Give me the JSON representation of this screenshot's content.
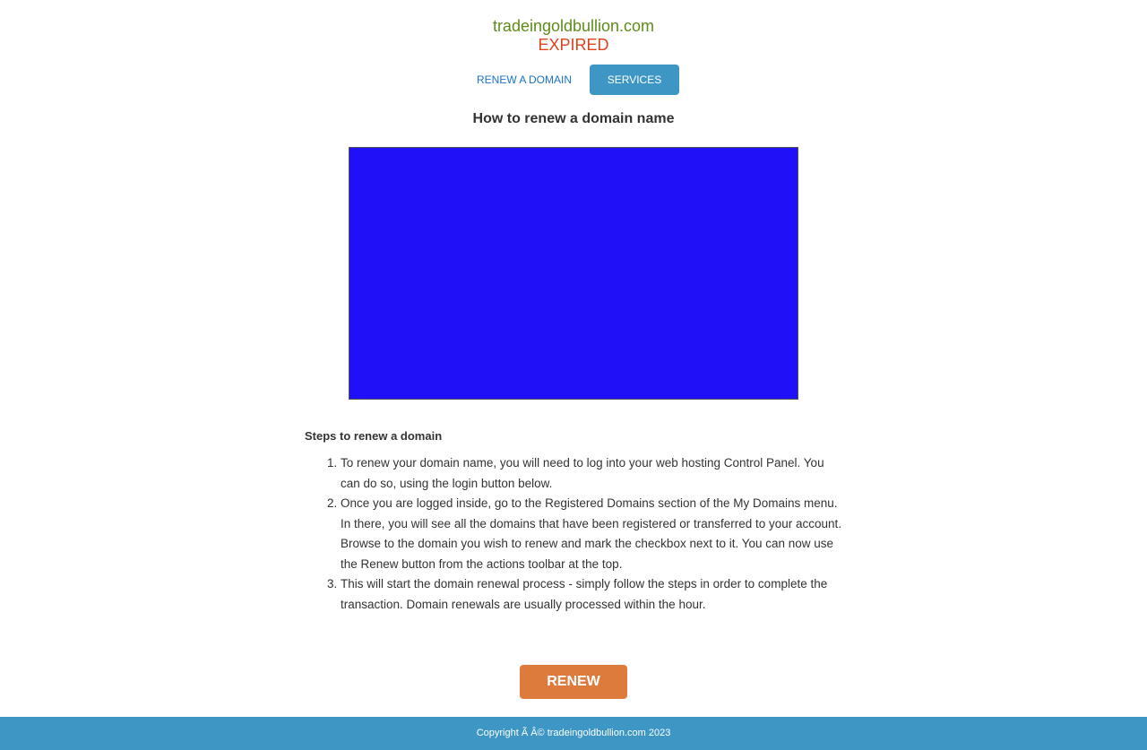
{
  "header": {
    "domain": "tradeingoldbullion.com",
    "status": "EXPIRED"
  },
  "nav": {
    "renew_link": "RENEW A DOMAIN",
    "services_button": "SERVICES"
  },
  "main": {
    "title": "How to renew a domain name",
    "steps_title": "Steps to renew a domain",
    "steps": [
      "To renew your domain name, you will need to log into your web hosting Control Panel. You can do so, using the login button below.",
      "Once you are logged inside, go to the Registered Domains section of the My Domains menu. In there, you will see all the domains that have been registered or transferred to your account. Browse to the domain you wish to renew and mark the checkbox next to it. You can now use the Renew button from the actions toolbar at the top.",
      "This will start the domain renewal process - simply follow the steps in order to complete the transaction. Domain renewals are usually processed within the hour."
    ],
    "renew_button": "RENEW"
  },
  "footer": {
    "copyright": "Copyright Ã   Â© tradeingoldbullion.com 2023"
  },
  "colors": {
    "domain_text": "#5e8c1a",
    "status_text": "#e0421b",
    "accent_blue": "#3d96c4",
    "video_placeholder": "#2010f7",
    "renew_orange": "#dd7b3c"
  }
}
